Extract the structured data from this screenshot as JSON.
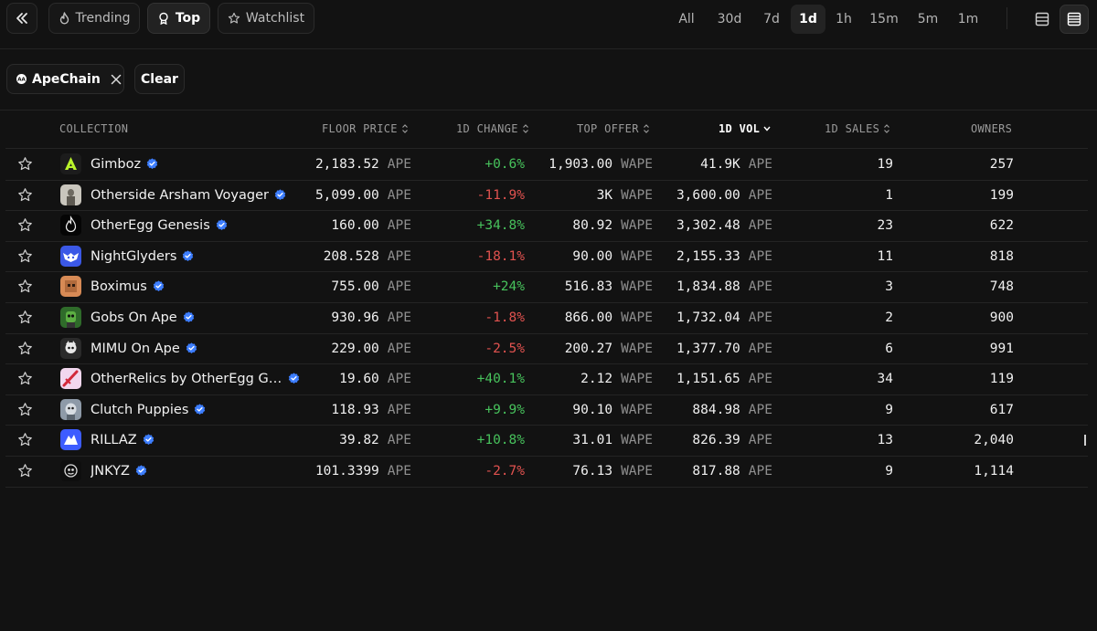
{
  "nav": {
    "tabs": [
      {
        "label": "Trending",
        "active": false
      },
      {
        "label": "Top",
        "active": true
      },
      {
        "label": "Watchlist",
        "active": false
      }
    ],
    "time_filters": [
      "All",
      "30d",
      "7d",
      "1d",
      "1h",
      "15m",
      "5m",
      "1m"
    ],
    "active_time_filter": "1d"
  },
  "filters": {
    "chain_chip": "ApeChain",
    "clear_label": "Clear"
  },
  "table": {
    "headers": {
      "collection": "COLLECTION",
      "floor_price": "FLOOR PRICE",
      "change": "1D CHANGE",
      "top_offer": "TOP OFFER",
      "volume": "1D VOL",
      "sales": "1D SALES",
      "owners": "OWNERS"
    },
    "rows": [
      {
        "name": "Gimboz",
        "floor": "2,183.52",
        "floor_unit": "APE",
        "change": "+0.6%",
        "offer": "1,903.00",
        "offer_unit": "WAPE",
        "vol": "41.9K",
        "vol_unit": "APE",
        "sales": "19",
        "owners": "257"
      },
      {
        "name": "Otherside Arsham Voyager",
        "floor": "5,099.00",
        "floor_unit": "APE",
        "change": "-11.9%",
        "offer": "3K",
        "offer_unit": "WAPE",
        "vol": "3,600.00",
        "vol_unit": "APE",
        "sales": "1",
        "owners": "199"
      },
      {
        "name": "OtherEgg Genesis",
        "floor": "160.00",
        "floor_unit": "APE",
        "change": "+34.8%",
        "offer": "80.92",
        "offer_unit": "WAPE",
        "vol": "3,302.48",
        "vol_unit": "APE",
        "sales": "23",
        "owners": "622"
      },
      {
        "name": "NightGlyders",
        "floor": "208.528",
        "floor_unit": "APE",
        "change": "-18.1%",
        "offer": "90.00",
        "offer_unit": "WAPE",
        "vol": "2,155.33",
        "vol_unit": "APE",
        "sales": "11",
        "owners": "818"
      },
      {
        "name": "Boximus",
        "floor": "755.00",
        "floor_unit": "APE",
        "change": "+24%",
        "offer": "516.83",
        "offer_unit": "WAPE",
        "vol": "1,834.88",
        "vol_unit": "APE",
        "sales": "3",
        "owners": "748"
      },
      {
        "name": "Gobs On Ape",
        "floor": "930.96",
        "floor_unit": "APE",
        "change": "-1.8%",
        "offer": "866.00",
        "offer_unit": "WAPE",
        "vol": "1,732.04",
        "vol_unit": "APE",
        "sales": "2",
        "owners": "900"
      },
      {
        "name": "MIMU On Ape",
        "floor": "229.00",
        "floor_unit": "APE",
        "change": "-2.5%",
        "offer": "200.27",
        "offer_unit": "WAPE",
        "vol": "1,377.70",
        "vol_unit": "APE",
        "sales": "6",
        "owners": "991"
      },
      {
        "name": "OtherRelics by OtherEgg Ge...",
        "floor": "19.60",
        "floor_unit": "APE",
        "change": "+40.1%",
        "offer": "2.12",
        "offer_unit": "WAPE",
        "vol": "1,151.65",
        "vol_unit": "APE",
        "sales": "34",
        "owners": "119"
      },
      {
        "name": "Clutch Puppies",
        "floor": "118.93",
        "floor_unit": "APE",
        "change": "+9.9%",
        "offer": "90.10",
        "offer_unit": "WAPE",
        "vol": "884.98",
        "vol_unit": "APE",
        "sales": "9",
        "owners": "617"
      },
      {
        "name": "RILLAZ",
        "floor": "39.82",
        "floor_unit": "APE",
        "change": "+10.8%",
        "offer": "31.01",
        "offer_unit": "WAPE",
        "vol": "826.39",
        "vol_unit": "APE",
        "sales": "13",
        "owners": "2,040"
      },
      {
        "name": "JNKYZ",
        "floor": "101.3399",
        "floor_unit": "APE",
        "change": "-2.7%",
        "offer": "76.13",
        "offer_unit": "WAPE",
        "vol": "817.88",
        "vol_unit": "APE",
        "sales": "9",
        "owners": "1,114"
      }
    ]
  },
  "colors": {
    "positive": "#47c25c",
    "negative": "#e0524f",
    "verified": "#3d7eff",
    "background": "#121212"
  }
}
